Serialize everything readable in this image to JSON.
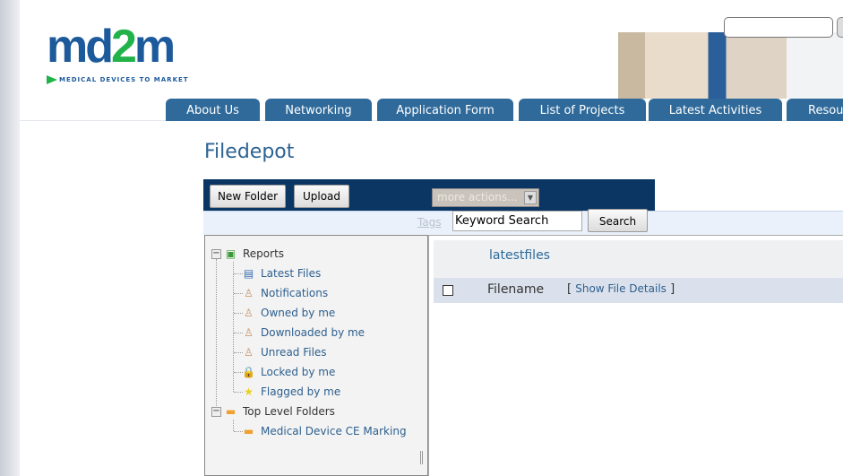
{
  "logo": {
    "text_main": "md",
    "text_two": "2",
    "text_end": "m",
    "tagline": "MEDICAL DEVICES TO MARKET"
  },
  "nav": {
    "tabs": [
      {
        "label": "About Us"
      },
      {
        "label": "Networking"
      },
      {
        "label": "Application Form"
      },
      {
        "label": "List of Projects"
      },
      {
        "label": "Latest Activities"
      },
      {
        "label": "Resources"
      }
    ]
  },
  "page": {
    "title": "Filedepot"
  },
  "toolbar": {
    "new_folder": "New Folder",
    "upload": "Upload",
    "more_actions": "more actions..."
  },
  "search": {
    "tags_link": "Tags",
    "keyword_value": "Keyword Search",
    "search_button": "Search"
  },
  "tree": {
    "reports": "Reports",
    "report_items": [
      {
        "label": "Latest Files",
        "icon": "list-icon"
      },
      {
        "label": "Notifications",
        "icon": "user-icon"
      },
      {
        "label": "Owned by me",
        "icon": "user-icon"
      },
      {
        "label": "Downloaded by me",
        "icon": "user-icon"
      },
      {
        "label": "Unread Files",
        "icon": "user-icon"
      },
      {
        "label": "Locked by me",
        "icon": "lock-icon"
      },
      {
        "label": "Flagged by me",
        "icon": "star-icon"
      }
    ],
    "top_level": "Top Level Folders",
    "folders": [
      {
        "label": "Medical Device CE Marking"
      }
    ]
  },
  "main": {
    "heading": "latestfiles",
    "col_filename": "Filename",
    "show_details": "Show File Details",
    "bracket_open": "[",
    "bracket_close": "]"
  }
}
